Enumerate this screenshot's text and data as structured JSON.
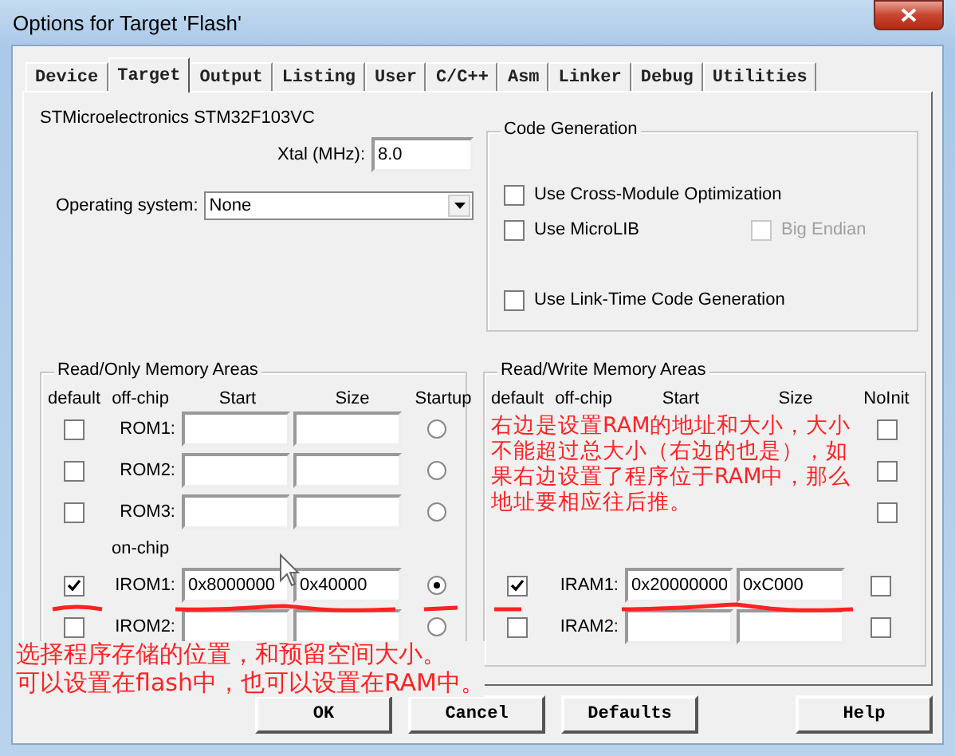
{
  "window": {
    "title": "Options for Target 'Flash'"
  },
  "tabs": [
    {
      "label": "Device",
      "selected": false
    },
    {
      "label": "Target",
      "selected": true
    },
    {
      "label": "Output",
      "selected": false
    },
    {
      "label": "Listing",
      "selected": false
    },
    {
      "label": "User",
      "selected": false
    },
    {
      "label": "C/C++",
      "selected": false
    },
    {
      "label": "Asm",
      "selected": false
    },
    {
      "label": "Linker",
      "selected": false
    },
    {
      "label": "Debug",
      "selected": false
    },
    {
      "label": "Utilities",
      "selected": false
    }
  ],
  "device": "STMicroelectronics STM32F103VC",
  "xtal": {
    "label": "Xtal (MHz):",
    "value": "8.0"
  },
  "operating_system": {
    "label": "Operating system:",
    "value": "None"
  },
  "code_generation": {
    "title": "Code Generation",
    "rows": [
      {
        "options": [
          {
            "label": "Use Cross-Module Optimization",
            "checked": false,
            "disabled": false
          }
        ]
      },
      {
        "options": [
          {
            "label": "Use MicroLIB",
            "checked": false,
            "disabled": false
          },
          {
            "label": "Big Endian",
            "checked": false,
            "disabled": true
          }
        ]
      },
      {
        "options": [
          {
            "label": "Use Link-Time Code Generation",
            "checked": false,
            "disabled": false
          }
        ]
      }
    ]
  },
  "rom_areas": {
    "title": "Read/Only Memory Areas",
    "columns": [
      "default",
      "off-chip",
      "Start",
      "Size",
      "Startup"
    ],
    "rows": [
      {
        "kind": "area",
        "label": "ROM1:",
        "default": false,
        "selected": false
      },
      {
        "kind": "area",
        "label": "ROM2:",
        "default": false,
        "selected": false
      },
      {
        "kind": "area",
        "label": "ROM3:",
        "default": false,
        "selected": false
      },
      {
        "kind": "heading",
        "label": "on-chip"
      },
      {
        "kind": "area",
        "label": "IROM1:",
        "default": true,
        "start": "0x8000000",
        "size": "0x40000",
        "selected": true
      },
      {
        "kind": "area",
        "label": "IROM2:",
        "default": false,
        "selected": false
      }
    ]
  },
  "ram_areas": {
    "title": "Read/Write Memory Areas",
    "columns": [
      "default",
      "off-chip",
      "Start",
      "Size",
      "NoInit"
    ],
    "rows": [
      {
        "kind": "covered",
        "noinit": false
      },
      {
        "kind": "covered",
        "noinit": false
      },
      {
        "kind": "covered",
        "noinit": false
      },
      {
        "kind": "area",
        "label": "IRAM1:",
        "default": true,
        "start": "0x20000000",
        "size": "0xC000",
        "noinit": false
      },
      {
        "kind": "area",
        "label": "IRAM2:",
        "default": false,
        "noinit": false
      }
    ]
  },
  "buttons": [
    "OK",
    "Cancel",
    "Defaults",
    "Help"
  ],
  "annotations": [
    {
      "lines": [
        "选择程序存储的位置，和预留空间大小。",
        "可以设置在flash中，也可以设置在RAM中。"
      ]
    },
    {
      "lines": [
        "右边是设置RAM的地址和大小，大小",
        "不能超过总大小（右边的也是），如",
        "果右边设置了程序位于RAM中，那么",
        "地址要相应往后推。"
      ]
    }
  ]
}
